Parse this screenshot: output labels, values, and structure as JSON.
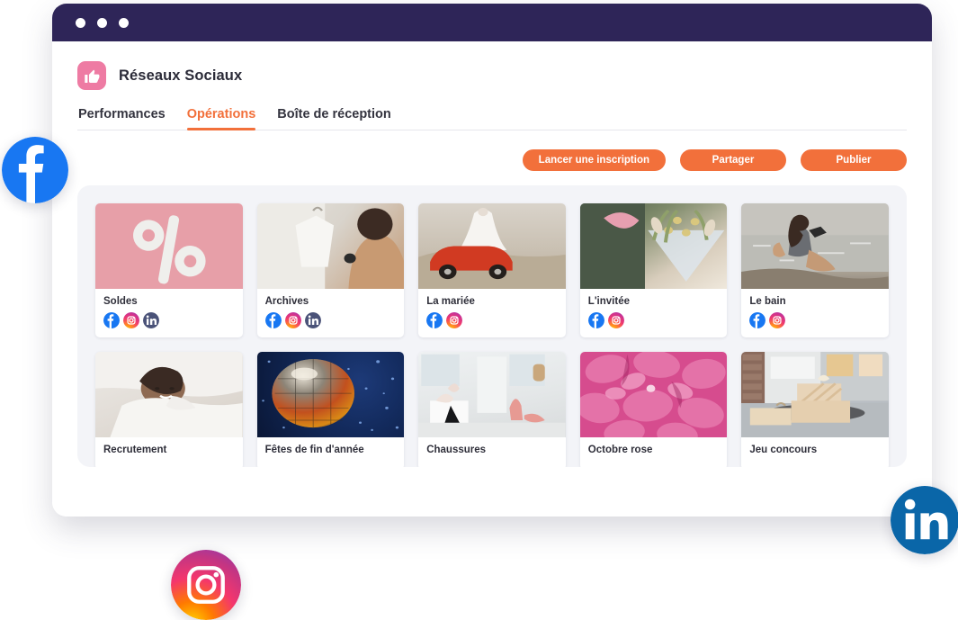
{
  "window": {
    "title_bar_color": "#2E2558",
    "dots": [
      "window-dot-1",
      "window-dot-2",
      "window-dot-3"
    ]
  },
  "app": {
    "logo_icon": "thumbs-up-icon",
    "logo_color": "#EE7BA3",
    "name": "Réseaux Sociaux"
  },
  "tabs": [
    {
      "label": "Performances",
      "active": false
    },
    {
      "label": "Opérations",
      "active": true
    },
    {
      "label": "Boîte de réception",
      "active": false
    }
  ],
  "accent_color": "#F2703B",
  "actions": [
    {
      "label": "Lancer une inscription"
    },
    {
      "label": "Partager"
    },
    {
      "label": "Publier"
    }
  ],
  "cards": [
    {
      "label": "Soldes",
      "socials": [
        "facebook",
        "instagram",
        "linkedin"
      ],
      "thumb": "percent-sign-on-pink"
    },
    {
      "label": "Archives",
      "socials": [
        "facebook",
        "instagram",
        "linkedin"
      ],
      "thumb": "woman-with-white-shirt-hanger"
    },
    {
      "label": "La mariée",
      "socials": [
        "facebook",
        "instagram"
      ],
      "thumb": "bride-on-red-car"
    },
    {
      "label": "L'invitée",
      "socials": [
        "facebook",
        "instagram"
      ],
      "thumb": "dried-flower-bouquet"
    },
    {
      "label": "Le bain",
      "socials": [
        "facebook",
        "instagram"
      ],
      "thumb": "woman-photographing-at-beach"
    },
    {
      "label": "Recrutement",
      "socials": [],
      "thumb": "woman-resting-on-white-bed"
    },
    {
      "label": "Fêtes de fin d'année",
      "socials": [],
      "thumb": "disco-ball-on-blue"
    },
    {
      "label": "Chaussures",
      "socials": [],
      "thumb": "shoes-in-bright-showroom"
    },
    {
      "label": "Octobre rose",
      "socials": [],
      "thumb": "pink-hydrangea-petals"
    },
    {
      "label": "Jeu concours",
      "socials": [],
      "thumb": "gift-parcels-on-doorstep"
    }
  ],
  "floating_badges": [
    {
      "name": "facebook",
      "color": "#1877F2"
    },
    {
      "name": "linkedin",
      "color": "#0A66A8"
    },
    {
      "name": "instagram",
      "color": "#E1306C"
    }
  ]
}
